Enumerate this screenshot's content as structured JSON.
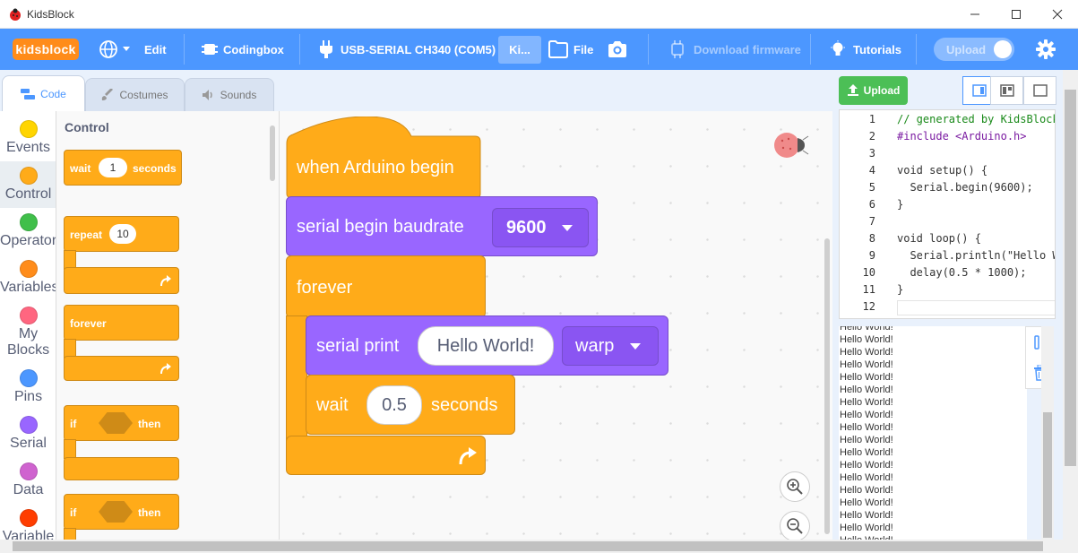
{
  "window": {
    "title": "KidsBlock"
  },
  "menubar": {
    "logo": "kidsblock",
    "edit": "Edit",
    "codingbox": "Codingbox",
    "port": "USB-SERIAL CH340 (COM5)",
    "kids_tab": "Ki...",
    "file": "File",
    "download_firmware": "Download firmware",
    "tutorials": "Tutorials",
    "upload_toggle": "Upload"
  },
  "tabs": {
    "code": "Code",
    "costumes": "Costumes",
    "sounds": "Sounds"
  },
  "categories": [
    {
      "label": "Events",
      "color": "#ffd500"
    },
    {
      "label": "Control",
      "color": "#ffab19"
    },
    {
      "label": "Operators",
      "color": "#40bf4a"
    },
    {
      "label": "Variables",
      "color": "#ff8c1a"
    },
    {
      "label": "My Blocks",
      "color": "#ff6680"
    },
    {
      "label": "Pins",
      "color": "#4c97ff"
    },
    {
      "label": "Serial",
      "color": "#9966ff"
    },
    {
      "label": "Data",
      "color": "#cf63cf"
    },
    {
      "label": "Variable",
      "color": "#ff3d00"
    }
  ],
  "palette": {
    "title": "Control",
    "wait": {
      "label": "wait",
      "value": "1",
      "suffix": "seconds"
    },
    "repeat": {
      "label": "repeat",
      "value": "10"
    },
    "forever": {
      "label": "forever"
    },
    "if1": {
      "label": "if",
      "then": "then"
    },
    "if2": {
      "label": "if",
      "then": "then"
    }
  },
  "workspace": {
    "hat": "when Arduino begin",
    "serial_begin": {
      "label": "serial begin baudrate",
      "value": "9600"
    },
    "forever": "forever",
    "serial_print": {
      "label": "serial print",
      "text": "Hello World!",
      "mode": "warp"
    },
    "wait": {
      "label": "wait",
      "value": "0.5",
      "suffix": "seconds"
    }
  },
  "right_panel": {
    "upload_button": "Upload",
    "code_lines": [
      {
        "n": "1",
        "text": "// generated by KidsBlock",
        "color": "#1a8a1a"
      },
      {
        "n": "2",
        "text": "#include <Arduino.h>",
        "color": "#7a1aa1"
      },
      {
        "n": "3",
        "text": "",
        "color": "#333333"
      },
      {
        "n": "4",
        "text": "void setup() {",
        "color": "#333333"
      },
      {
        "n": "5",
        "text": "  Serial.begin(9600);",
        "color": "#333333"
      },
      {
        "n": "6",
        "text": "}",
        "color": "#333333"
      },
      {
        "n": "7",
        "text": "",
        "color": "#333333"
      },
      {
        "n": "8",
        "text": "void loop() {",
        "color": "#333333"
      },
      {
        "n": "9",
        "text": "  Serial.println(\"Hello World!\");",
        "color": "#333333"
      },
      {
        "n": "10",
        "text": "  delay(0.5 * 1000);",
        "color": "#333333"
      },
      {
        "n": "11",
        "text": "}",
        "color": "#333333"
      },
      {
        "n": "12",
        "text": "",
        "color": "#333333"
      }
    ],
    "serial_lines": [
      "Hello World!",
      "Hello World!",
      "Hello World!",
      "Hello World!",
      "Hello World!",
      "Hello World!",
      "Hello World!",
      "Hello World!",
      "Hello World!",
      "Hello World!",
      "Hello World!",
      "Hello World!",
      "Hello World!",
      "Hello World!",
      "Hello World!",
      "Hello World!",
      "Hello World!",
      "Hello World!",
      "Hello World!"
    ]
  },
  "colors": {
    "menubar": "#4c97ff",
    "control": "#ffab19",
    "serial": "#9966ff",
    "upload_green": "#4cbf56"
  }
}
